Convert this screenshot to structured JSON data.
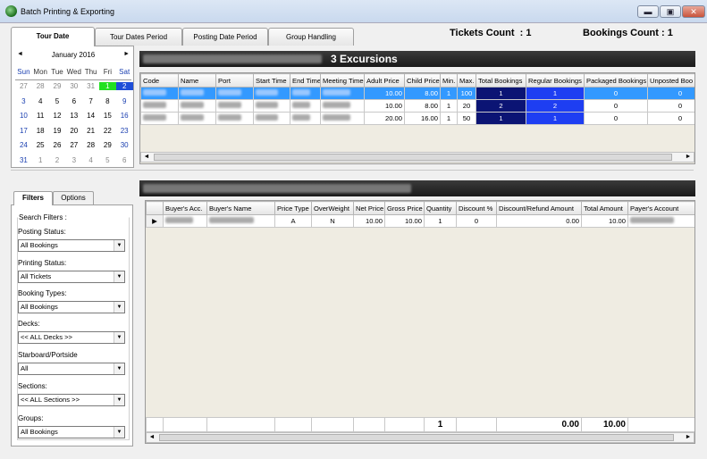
{
  "window": {
    "title": "Batch Printing & Exporting",
    "minimize": "▬",
    "restore": "▣",
    "close": "✕"
  },
  "tabs": [
    "Tour Date",
    "Tour Dates Period",
    "Posting Date Period",
    "Group Handling"
  ],
  "counts": {
    "tickets_label": "Tickets Count",
    "tickets_value": "1",
    "bookings_label": "Bookings Count :",
    "bookings_value": "1",
    "colon": ":"
  },
  "calendar": {
    "month": "January 2016",
    "prev": "◄",
    "next": "►",
    "dow": [
      "Sun",
      "Mon",
      "Tue",
      "Wed",
      "Thu",
      "Fri",
      "Sat"
    ],
    "weeks": [
      [
        "27",
        "28",
        "29",
        "30",
        "31",
        "1",
        "2"
      ],
      [
        "3",
        "4",
        "5",
        "6",
        "7",
        "8",
        "9"
      ],
      [
        "10",
        "11",
        "12",
        "13",
        "14",
        "15",
        "16"
      ],
      [
        "17",
        "18",
        "19",
        "20",
        "21",
        "22",
        "23"
      ],
      [
        "24",
        "25",
        "26",
        "27",
        "28",
        "29",
        "30"
      ],
      [
        "31",
        "1",
        "2",
        "3",
        "4",
        "5",
        "6"
      ]
    ]
  },
  "excursions": {
    "header": "3 Excursions",
    "columns": [
      "Code",
      "Name",
      "Port",
      "Start Time",
      "End Time",
      "Meeting Time",
      "Adult Price",
      "Child Price",
      "Min.",
      "Max.",
      "Total Bookings",
      "Regular Bookings",
      "Packaged Bookings",
      "Unposted Boo"
    ],
    "rows": [
      {
        "adult": "10.00",
        "child": "8.00",
        "min": "1",
        "max": "100",
        "total": "1",
        "regular": "1",
        "packaged": "0",
        "unposted": "0"
      },
      {
        "adult": "10.00",
        "child": "8.00",
        "min": "1",
        "max": "20",
        "total": "2",
        "regular": "2",
        "packaged": "0",
        "unposted": "0"
      },
      {
        "adult": "20.00",
        "child": "16.00",
        "min": "1",
        "max": "50",
        "total": "1",
        "regular": "1",
        "packaged": "0",
        "unposted": "0"
      }
    ]
  },
  "bookings": {
    "columns": [
      "",
      "Buyer's Acc.",
      "Buyer's Name",
      "Price Type",
      "OverWeight",
      "Net Price",
      "Gross Price",
      "Quantity",
      "Discount %",
      "Discount/Refund Amount",
      "Total Amount",
      "Payer's Account"
    ],
    "row": {
      "marker": "▶",
      "price_type": "A",
      "overweight": "N",
      "net": "10.00",
      "gross": "10.00",
      "qty": "1",
      "disc": "0",
      "refund": "0.00",
      "total": "10.00"
    },
    "footer": {
      "qty": "1",
      "refund": "0.00",
      "total": "10.00"
    }
  },
  "filters": {
    "tabs": [
      "Filters",
      "Options"
    ],
    "group_label": "Search Filters :",
    "items": [
      {
        "label": "Posting Status:",
        "value": "All Bookings"
      },
      {
        "label": "Printing Status:",
        "value": "All Tickets"
      },
      {
        "label": "Booking Types:",
        "value": "All Bookings"
      },
      {
        "label": "Decks:",
        "value": "<< ALL Decks >>"
      },
      {
        "label": "Starboard/Portside",
        "value": "All"
      },
      {
        "label": "Sections:",
        "value": "<< ALL Sections >>"
      },
      {
        "label": "Groups:",
        "value": "All Bookings"
      }
    ],
    "dropdown_glyph": "▼"
  },
  "scroll": {
    "left": "◄",
    "right": "►"
  }
}
